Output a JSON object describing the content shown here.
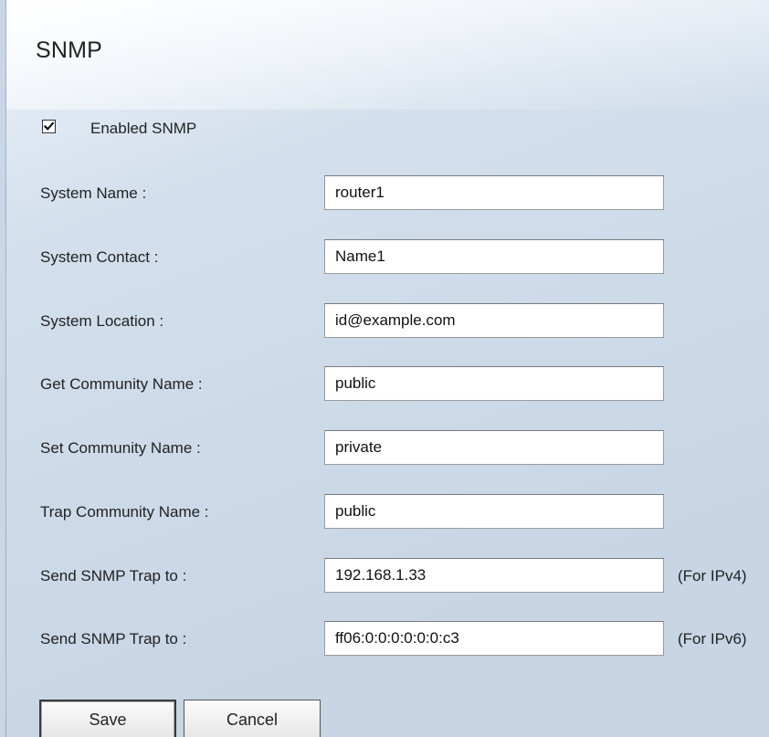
{
  "title": "SNMP",
  "enabled": {
    "label": "Enabled SNMP",
    "checked": true
  },
  "fields": {
    "system_name": {
      "label": "System Name :",
      "value": "router1"
    },
    "system_contact": {
      "label": "System Contact :",
      "value": "Name1"
    },
    "system_location": {
      "label": "System Location :",
      "value": "id@example.com"
    },
    "get_community": {
      "label": "Get Community Name :",
      "value": "public"
    },
    "set_community": {
      "label": "Set Community Name :",
      "value": "private"
    },
    "trap_community": {
      "label": "Trap Community Name :",
      "value": "public"
    },
    "trap_ipv4": {
      "label": "Send SNMP Trap to :",
      "value": "192.168.1.33",
      "note": "(For IPv4)"
    },
    "trap_ipv6": {
      "label": "Send SNMP Trap to :",
      "value": "ff06:0:0:0:0:0:0:c3",
      "note": "(For IPv6)"
    }
  },
  "buttons": {
    "save": "Save",
    "cancel": "Cancel"
  }
}
